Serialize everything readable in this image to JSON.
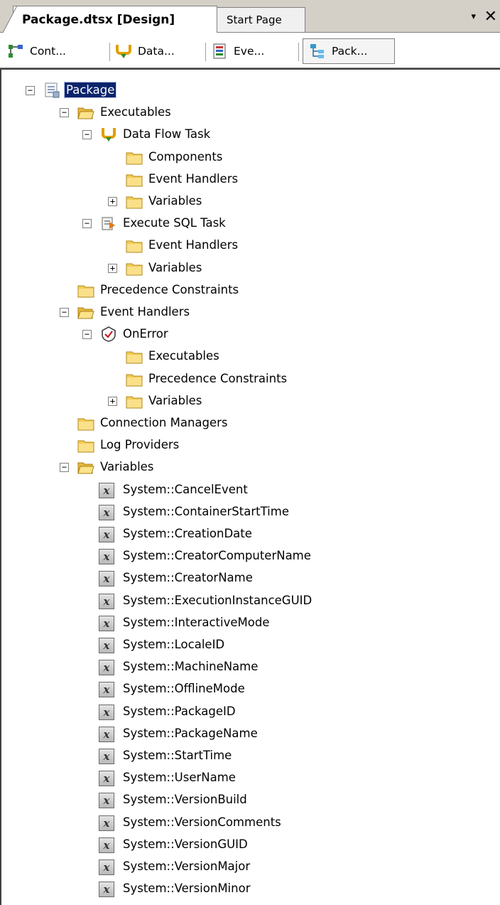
{
  "doc_tabs": [
    {
      "label": "Package.dtsx [Design]",
      "active": true
    },
    {
      "label": "Start Page",
      "active": false
    }
  ],
  "tab_controls": {
    "dropdown_icon": "▾",
    "close_icon": "✕"
  },
  "view_tabs": [
    {
      "label": "Cont...",
      "icon": "control-flow-icon"
    },
    {
      "label": "Data...",
      "icon": "data-flow-icon"
    },
    {
      "label": "Eve...",
      "icon": "event-handlers-icon"
    },
    {
      "label": "Pack...",
      "icon": "package-explorer-icon",
      "selected": true
    }
  ],
  "tree": [
    {
      "label": "Package",
      "level": 0,
      "icon": "package-icon",
      "expander": "minus",
      "selected": true
    },
    {
      "label": "Executables",
      "level": 1,
      "icon": "folder-open-icon",
      "expander": "minus"
    },
    {
      "label": "Data Flow Task",
      "level": 2,
      "icon": "data-flow-task-icon",
      "expander": "minus"
    },
    {
      "label": "Components",
      "level": 3,
      "icon": "folder-icon"
    },
    {
      "label": "Event Handlers",
      "level": 3,
      "icon": "folder-icon"
    },
    {
      "label": "Variables",
      "level": 3,
      "icon": "folder-icon",
      "expander": "plus"
    },
    {
      "label": "Execute SQL Task",
      "level": 2,
      "icon": "execute-sql-task-icon",
      "expander": "minus"
    },
    {
      "label": "Event Handlers",
      "level": 3,
      "icon": "folder-icon"
    },
    {
      "label": "Variables",
      "level": 3,
      "icon": "folder-icon",
      "expander": "plus"
    },
    {
      "label": "Precedence Constraints",
      "level": 1,
      "icon": "folder-icon"
    },
    {
      "label": "Event Handlers",
      "level": 1,
      "icon": "folder-open-icon",
      "expander": "minus"
    },
    {
      "label": "OnError",
      "level": 2,
      "icon": "on-error-icon",
      "expander": "minus"
    },
    {
      "label": "Executables",
      "level": 3,
      "icon": "folder-icon"
    },
    {
      "label": "Precedence Constraints",
      "level": 3,
      "icon": "folder-icon"
    },
    {
      "label": "Variables",
      "level": 3,
      "icon": "folder-icon",
      "expander": "plus"
    },
    {
      "label": "Connection Managers",
      "level": 1,
      "icon": "folder-icon"
    },
    {
      "label": "Log Providers",
      "level": 1,
      "icon": "folder-icon"
    },
    {
      "label": "Variables",
      "level": 1,
      "icon": "folder-open-icon",
      "expander": "minus"
    },
    {
      "label": "System::CancelEvent",
      "level": 2,
      "icon": "variable-icon"
    },
    {
      "label": "System::ContainerStartTime",
      "level": 2,
      "icon": "variable-icon"
    },
    {
      "label": "System::CreationDate",
      "level": 2,
      "icon": "variable-icon"
    },
    {
      "label": "System::CreatorComputerName",
      "level": 2,
      "icon": "variable-icon"
    },
    {
      "label": "System::CreatorName",
      "level": 2,
      "icon": "variable-icon"
    },
    {
      "label": "System::ExecutionInstanceGUID",
      "level": 2,
      "icon": "variable-icon"
    },
    {
      "label": "System::InteractiveMode",
      "level": 2,
      "icon": "variable-icon"
    },
    {
      "label": "System::LocaleID",
      "level": 2,
      "icon": "variable-icon"
    },
    {
      "label": "System::MachineName",
      "level": 2,
      "icon": "variable-icon"
    },
    {
      "label": "System::OfflineMode",
      "level": 2,
      "icon": "variable-icon"
    },
    {
      "label": "System::PackageID",
      "level": 2,
      "icon": "variable-icon"
    },
    {
      "label": "System::PackageName",
      "level": 2,
      "icon": "variable-icon"
    },
    {
      "label": "System::StartTime",
      "level": 2,
      "icon": "variable-icon"
    },
    {
      "label": "System::UserName",
      "level": 2,
      "icon": "variable-icon"
    },
    {
      "label": "System::VersionBuild",
      "level": 2,
      "icon": "variable-icon"
    },
    {
      "label": "System::VersionComments",
      "level": 2,
      "icon": "variable-icon"
    },
    {
      "label": "System::VersionGUID",
      "level": 2,
      "icon": "variable-icon"
    },
    {
      "label": "System::VersionMajor",
      "level": 2,
      "icon": "variable-icon"
    },
    {
      "label": "System::VersionMinor",
      "level": 2,
      "icon": "variable-icon"
    }
  ],
  "colors": {
    "selection": "#0a246a",
    "chrome": "#d4d0c8"
  }
}
